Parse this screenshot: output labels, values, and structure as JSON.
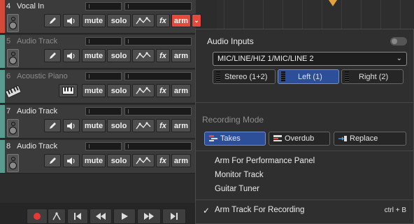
{
  "tracks": [
    {
      "number": "4",
      "name": "Vocal In",
      "color": "#d44a3a",
      "armed": true
    },
    {
      "number": "5",
      "name": "Audio Track",
      "color": "#5b9b8f",
      "armed": false
    },
    {
      "number": "6",
      "name": "Acoustic Piano",
      "color": "#5b9b8f",
      "armed": false
    },
    {
      "number": "7",
      "name": "Audio Track",
      "color": "#5b9b8f",
      "armed": false
    },
    {
      "number": "8",
      "name": "Audio Track",
      "color": "#5b9b8f",
      "armed": false
    }
  ],
  "buttons": {
    "mute": "mute",
    "solo": "solo",
    "fx": "fx",
    "arm": "arm"
  },
  "panel": {
    "title": "Audio Inputs",
    "input_select": "MIC/LINE/HIZ 1/MIC/LINE 2",
    "channels": [
      "Stereo (1+2)",
      "Left (1)",
      "Right (2)"
    ],
    "selected_channel": "Left (1)",
    "recording_mode_label": "Recording Mode",
    "modes": [
      "Takes",
      "Overdub",
      "Replace"
    ],
    "selected_mode": "Takes",
    "menu_items": [
      "Arm For Performance Panel",
      "Monitor Track",
      "Guitar Tuner"
    ],
    "checked_item": "Arm Track For Recording",
    "checked_shortcut": "ctrl + B"
  },
  "icons": {
    "input_monitor": "speaker-icon",
    "edit": "pencil-icon",
    "volume": "volume-icon",
    "automation": "automation-icon",
    "instrument": "keyboard-icon",
    "dropdown": "chevron-down-icon",
    "record": "record-icon",
    "rewind": "rewind-icon",
    "play": "play-icon",
    "fast_forward": "fast-forward-icon",
    "go_to_start": "go-to-start-icon",
    "go_to_end": "go-to-end-icon",
    "check": "checkmark-icon"
  },
  "colors": {
    "accent": "#2d4f9a",
    "arm": "#e24a3b",
    "marker": "#e3a33a"
  }
}
